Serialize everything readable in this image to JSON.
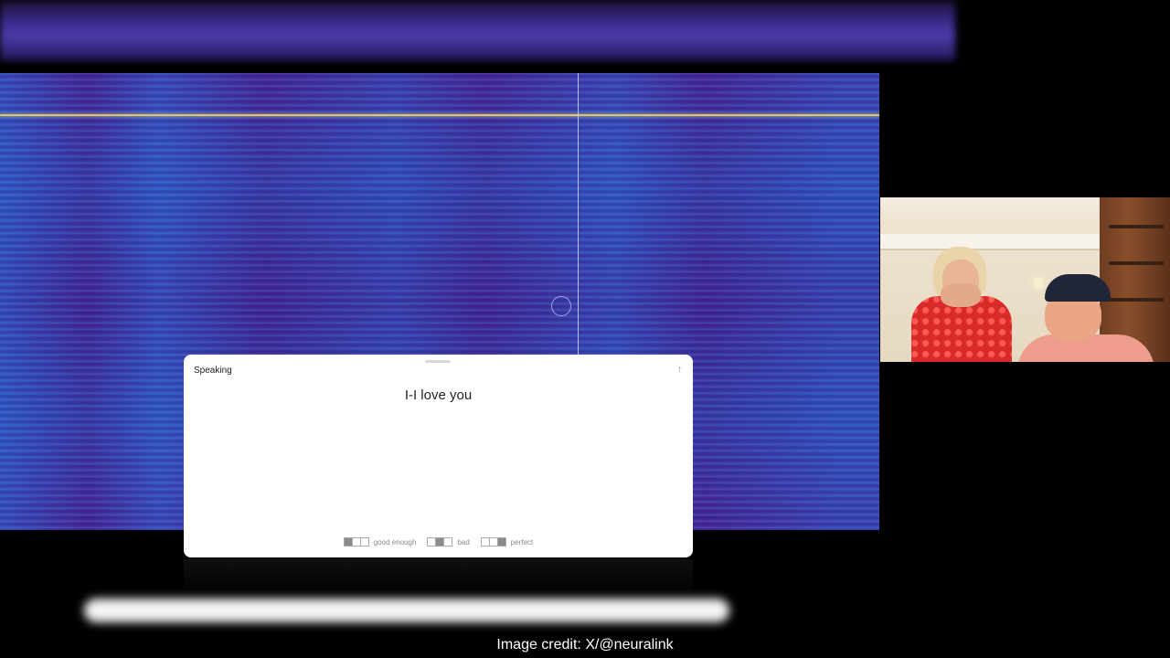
{
  "speech_panel": {
    "title": "Speaking",
    "transcript": "I-I love you",
    "expand_icon": "arrow-up-icon",
    "feedback_options": [
      {
        "label": "good enough",
        "filled": 1
      },
      {
        "label": "bad",
        "filled": 2
      },
      {
        "label": "perfect",
        "filled": 3
      }
    ]
  },
  "video_feed": {
    "icon": "video-call-feed"
  },
  "credit": "Image credit: X/@neuralink",
  "colors": {
    "spectrogram_base": "#3a1a82",
    "spectrogram_highlight": "#4a9ef0",
    "marker_line": "#d9c86a",
    "card_background": "#ffffff"
  }
}
